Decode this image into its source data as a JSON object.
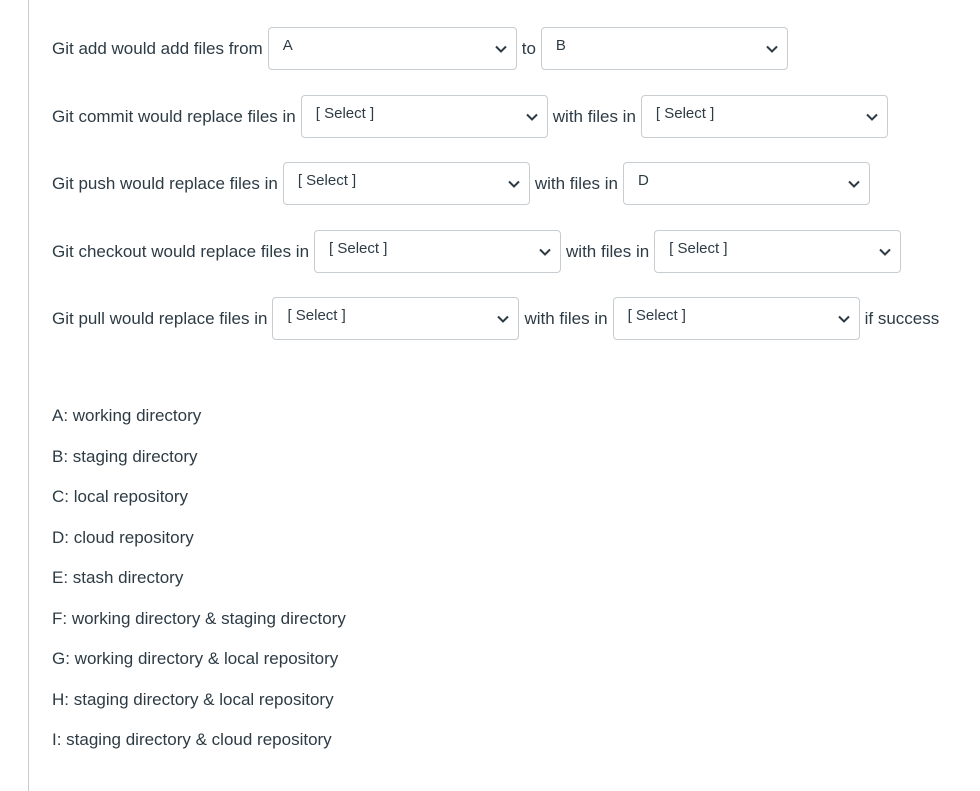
{
  "questions": [
    {
      "prefix": "Git add would add files from",
      "first_value": "A",
      "middle": "to",
      "second_value": "B",
      "suffix": ""
    },
    {
      "prefix": "Git commit would replace files in",
      "first_value": "[ Select ]",
      "middle": "with files in",
      "second_value": "[ Select ]",
      "suffix": ""
    },
    {
      "prefix": "Git push would replace files in",
      "first_value": "[ Select ]",
      "middle": "with files in",
      "second_value": "D",
      "suffix": ""
    },
    {
      "prefix": "Git checkout would replace files in",
      "first_value": "[ Select ]",
      "middle": "with files in",
      "second_value": "[ Select ]",
      "suffix": ""
    },
    {
      "prefix": "Git pull would replace files in",
      "first_value": "[ Select ]",
      "middle": "with files in",
      "second_value": "[ Select ]",
      "suffix": "if success"
    }
  ],
  "legend": [
    "A: working directory",
    "B: staging directory",
    "C: local repository",
    "D: cloud repository",
    "E: stash directory",
    "F: working directory & staging directory",
    "G: working directory & local repository",
    "H: staging directory & local repository",
    "I: staging directory & cloud repository"
  ],
  "icons": {
    "dropdown_arrow": "chevron-down-icon"
  },
  "colors": {
    "text": "#2d3b45",
    "border": "#c7cdd1",
    "background": "#ffffff"
  }
}
